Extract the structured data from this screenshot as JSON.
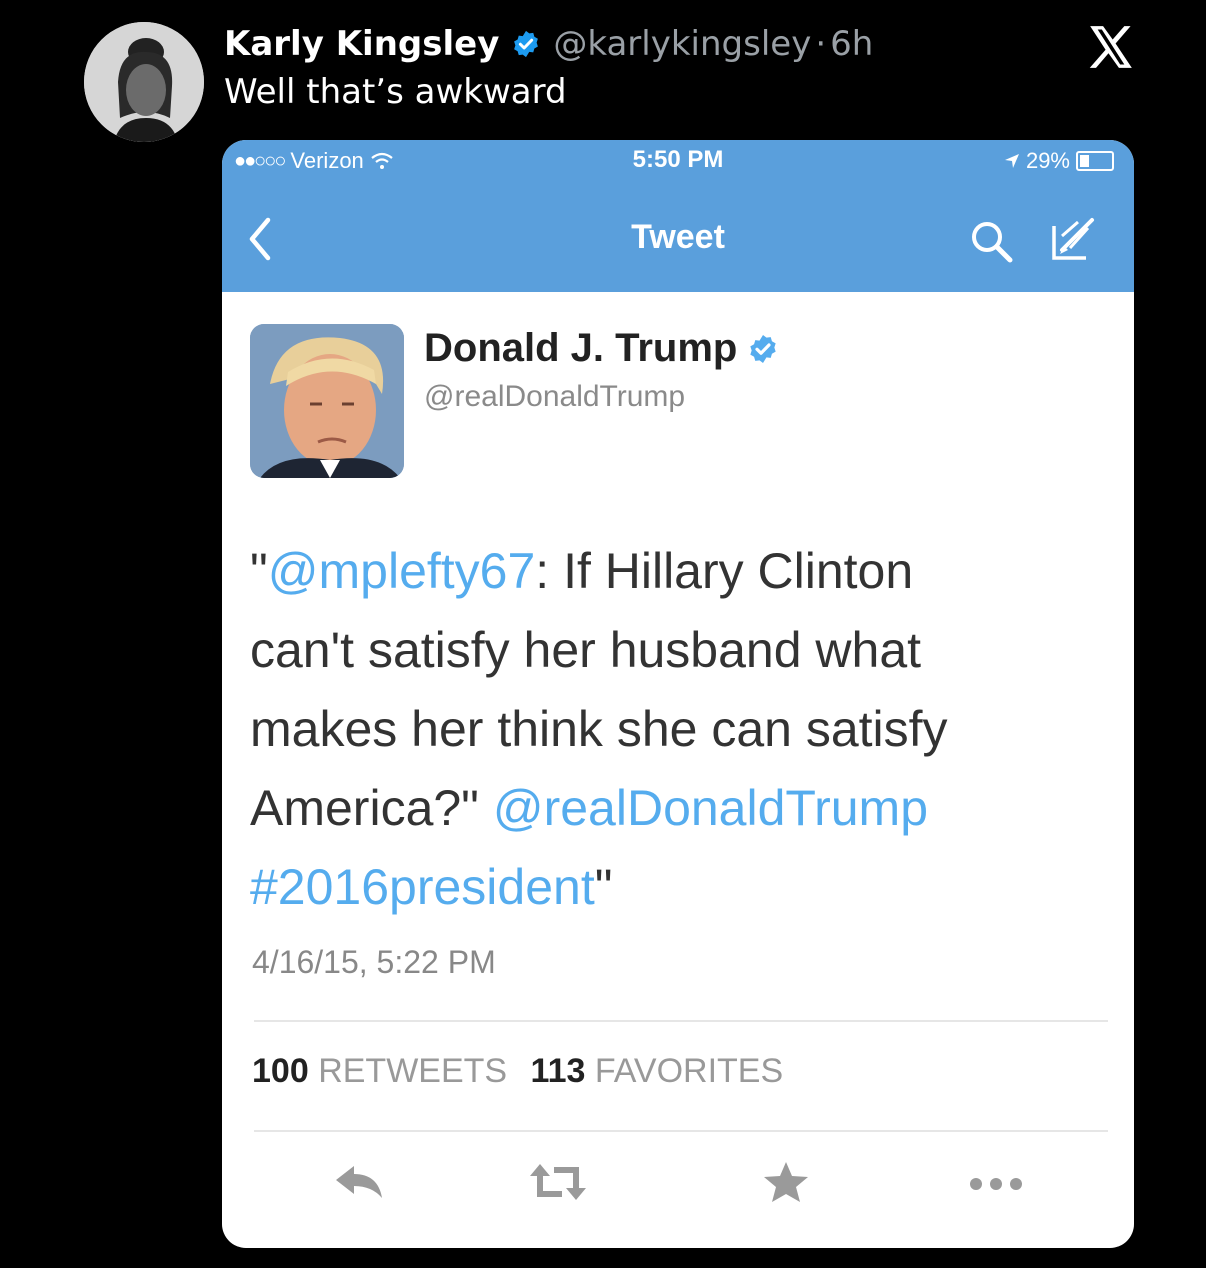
{
  "post": {
    "author_name": "Karly Kingsley",
    "author_handle": "@karlykingsley",
    "separator": "·",
    "time": "6h",
    "text": "Well that’s awkward"
  },
  "embedded": {
    "status_bar": {
      "signal": "●●○○○",
      "carrier": "Verizon",
      "time": "5:50 PM",
      "battery": "29%"
    },
    "nav": {
      "title": "Tweet"
    },
    "tweet": {
      "name": "Donald J. Trump",
      "handle": "@realDonaldTrump",
      "body": {
        "l1_open_quote": "\"",
        "l1_mention": "@mplefty67",
        "l1_rest": ":  If Hillary Clinton",
        "l2": "can't satisfy her husband what",
        "l3": "makes her think she can satisfy",
        "l4_text": "America?\" ",
        "l4_mention": "@realDonaldTrump",
        "l5_hashtag": "#2016president",
        "l5_close_quote": "\""
      },
      "date": "4/16/15, 5:22 PM",
      "retweets_count": "100",
      "retweets_label": "RETWEETS",
      "favorites_count": "113",
      "favorites_label": "FAVORITES"
    },
    "colors": {
      "header_blue": "#5a9fdc",
      "link_blue": "#55acee",
      "verified_blue": "#1d9bf0"
    }
  }
}
